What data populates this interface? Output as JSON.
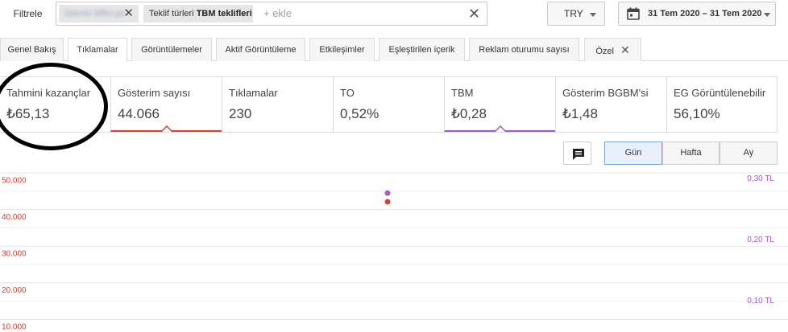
{
  "filterbar": {
    "filter_label": "Filtrele",
    "chip1_label": "Sitenin Mflm.ps",
    "chip2_prefix": "Teklif türleri",
    "chip2_value": "TBM teklifleri",
    "add_placeholder": "+ ekle"
  },
  "currency": {
    "value": "TRY"
  },
  "daterange": {
    "value": "31 Tem 2020 – 31 Tem 2020"
  },
  "tabs": [
    {
      "label": "Genel Bakış"
    },
    {
      "label": "Tıklamalar"
    },
    {
      "label": "Görüntülemeler"
    },
    {
      "label": "Aktif Görüntüleme"
    },
    {
      "label": "Etkileşimler"
    },
    {
      "label": "Eşleştirilen içerik"
    },
    {
      "label": "Reklam oturumu sayısı"
    },
    {
      "label": "Özel"
    }
  ],
  "metrics": [
    {
      "label": "Tahmini kazançlar",
      "value": "₺65,13"
    },
    {
      "label": "Gösterim sayısı",
      "value": "44.066"
    },
    {
      "label": "Tıklamalar",
      "value": "230"
    },
    {
      "label": "TO",
      "value": "0,52%"
    },
    {
      "label": "TBM",
      "value": "₺0,28"
    },
    {
      "label": "Gösterim BGBM'si",
      "value": "₺1,48"
    },
    {
      "label": "EG Görüntülenebilir",
      "value": "56,10%"
    }
  ],
  "granularity": {
    "day": "Gün",
    "week": "Hafta",
    "month": "Ay"
  },
  "colors": {
    "impressions": "#d04437",
    "cpc": "#a35acb"
  },
  "chart_data": {
    "type": "scatter",
    "left_axis": {
      "ticks": [
        "50.000",
        "40.000",
        "30.000",
        "20.000",
        "10.000"
      ],
      "ylim": [
        0,
        50000
      ]
    },
    "right_axis": {
      "ticks": [
        "0,30 TL",
        "0,20 TL",
        "0,10 TL"
      ],
      "ylim": [
        0,
        0.3
      ]
    },
    "x": [
      "31 Tem 2020"
    ],
    "series": [
      {
        "metric": "Gösterim sayısı",
        "axis": "left",
        "values": [
          44066
        ],
        "color": "#d04437"
      },
      {
        "metric": "TBM",
        "axis": "right",
        "values": [
          0.28
        ],
        "color": "#a35acb"
      }
    ]
  }
}
